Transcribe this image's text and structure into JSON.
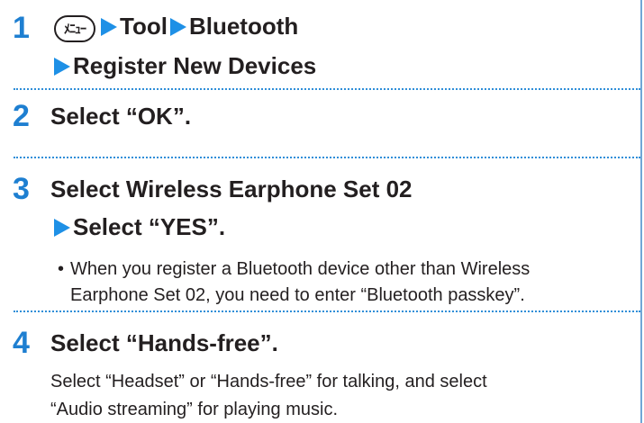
{
  "steps": [
    {
      "number": "1",
      "menu_key_label": "ﾒﾆｭｰ",
      "path_1": "Tool",
      "path_2": "Bluetooth",
      "path_3": "Register New Devices"
    },
    {
      "number": "2",
      "text": "Select “OK”."
    },
    {
      "number": "3",
      "text": "Select Wireless Earphone Set 02",
      "sub_text": "Select “YES”.",
      "note_line_1": "When you register a Bluetooth device other than Wireless",
      "note_line_2": "Earphone Set 02, you need to enter “Bluetooth passkey”.",
      "bullet": "•"
    },
    {
      "number": "4",
      "text": "Select “Hands-free”.",
      "desc_line_1": "Select “Headset” or “Hands-free” for talking, and select",
      "desc_line_2": "“Audio streaming” for playing music."
    }
  ],
  "colors": {
    "accent": "#1e7fd1",
    "arrow": "#1e90e6",
    "separator": "#2f8ed8",
    "text": "#231f20"
  },
  "icons": [
    "menu-key-icon",
    "arrow-right-icon"
  ]
}
